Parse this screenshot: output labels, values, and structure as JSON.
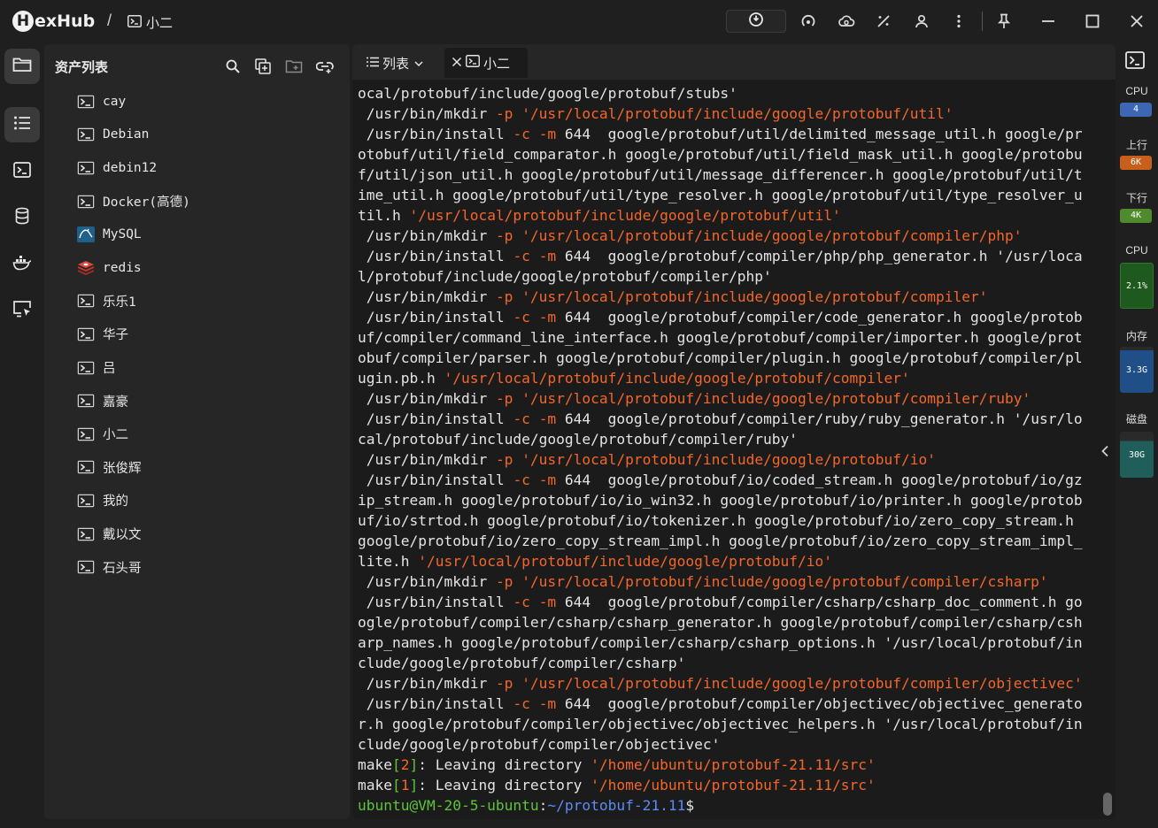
{
  "app": {
    "logo_letter": "H",
    "logo_text": "exHub",
    "breadcrumb_sep": "/",
    "breadcrumb_current": "小二"
  },
  "asset_panel": {
    "title": "资产列表",
    "items": [
      {
        "label": "cay",
        "icon": "terminal-icon"
      },
      {
        "label": "Debian",
        "icon": "terminal-icon"
      },
      {
        "label": "debin12",
        "icon": "terminal-icon"
      },
      {
        "label": "Docker(高德)",
        "icon": "terminal-icon"
      },
      {
        "label": "MySQL",
        "icon": "mysql-icon"
      },
      {
        "label": "redis",
        "icon": "redis-icon"
      },
      {
        "label": "乐乐1",
        "icon": "terminal-icon"
      },
      {
        "label": "华子",
        "icon": "terminal-icon"
      },
      {
        "label": "吕",
        "icon": "terminal-icon"
      },
      {
        "label": "嘉豪",
        "icon": "terminal-icon"
      },
      {
        "label": "小二",
        "icon": "terminal-icon"
      },
      {
        "label": "张俊辉",
        "icon": "terminal-icon"
      },
      {
        "label": "我的",
        "icon": "terminal-icon"
      },
      {
        "label": "戴以文",
        "icon": "terminal-icon"
      },
      {
        "label": "石头哥",
        "icon": "terminal-icon"
      }
    ]
  },
  "tabs": {
    "list_label": "列表",
    "active_label": "小二"
  },
  "terminal": {
    "lines": [
      [
        [
          "w",
          "ocal/protobuf/include/google/protobuf/stubs'"
        ]
      ],
      [
        [
          "w",
          " /usr/bin/mkdir "
        ],
        [
          "o",
          "-p"
        ],
        [
          "w",
          " "
        ],
        [
          "o",
          "'/usr/local/protobuf/include/google/protobuf/util'"
        ]
      ],
      [
        [
          "w",
          " /usr/bin/install "
        ],
        [
          "o",
          "-c"
        ],
        [
          "w",
          " "
        ],
        [
          "o",
          "-m"
        ],
        [
          "w",
          " 644  google/protobuf/util/delimited_message_util.h google/pr"
        ]
      ],
      [
        [
          "w",
          "otobuf/util/field_comparator.h google/protobuf/util/field_mask_util.h google/protobu"
        ]
      ],
      [
        [
          "w",
          "f/util/json_util.h google/protobuf/util/message_differencer.h google/protobuf/util/t"
        ]
      ],
      [
        [
          "w",
          "ime_util.h google/protobuf/util/type_resolver.h google/protobuf/util/type_resolver_u"
        ]
      ],
      [
        [
          "w",
          "til.h "
        ],
        [
          "o",
          "'/usr/local/protobuf/include/google/protobuf/util'"
        ]
      ],
      [
        [
          "w",
          " /usr/bin/mkdir "
        ],
        [
          "o",
          "-p"
        ],
        [
          "w",
          " "
        ],
        [
          "o",
          "'/usr/local/protobuf/include/google/protobuf/compiler/php'"
        ]
      ],
      [
        [
          "w",
          " /usr/bin/install "
        ],
        [
          "o",
          "-c"
        ],
        [
          "w",
          " "
        ],
        [
          "o",
          "-m"
        ],
        [
          "w",
          " 644  google/protobuf/compiler/php/php_generator.h '/usr/loca"
        ]
      ],
      [
        [
          "w",
          "l/protobuf/include/google/protobuf/compiler/php'"
        ]
      ],
      [
        [
          "w",
          " /usr/bin/mkdir "
        ],
        [
          "o",
          "-p"
        ],
        [
          "w",
          " "
        ],
        [
          "o",
          "'/usr/local/protobuf/include/google/protobuf/compiler'"
        ]
      ],
      [
        [
          "w",
          " /usr/bin/install "
        ],
        [
          "o",
          "-c"
        ],
        [
          "w",
          " "
        ],
        [
          "o",
          "-m"
        ],
        [
          "w",
          " 644  google/protobuf/compiler/code_generator.h google/protob"
        ]
      ],
      [
        [
          "w",
          "uf/compiler/command_line_interface.h google/protobuf/compiler/importer.h google/prot"
        ]
      ],
      [
        [
          "w",
          "obuf/compiler/parser.h google/protobuf/compiler/plugin.h google/protobuf/compiler/pl"
        ]
      ],
      [
        [
          "w",
          "ugin.pb.h "
        ],
        [
          "o",
          "'/usr/local/protobuf/include/google/protobuf/compiler'"
        ]
      ],
      [
        [
          "w",
          " /usr/bin/mkdir "
        ],
        [
          "o",
          "-p"
        ],
        [
          "w",
          " "
        ],
        [
          "o",
          "'/usr/local/protobuf/include/google/protobuf/compiler/ruby'"
        ]
      ],
      [
        [
          "w",
          " /usr/bin/install "
        ],
        [
          "o",
          "-c"
        ],
        [
          "w",
          " "
        ],
        [
          "o",
          "-m"
        ],
        [
          "w",
          " 644  google/protobuf/compiler/ruby/ruby_generator.h '/usr/lo"
        ]
      ],
      [
        [
          "w",
          "cal/protobuf/include/google/protobuf/compiler/ruby'"
        ]
      ],
      [
        [
          "w",
          " /usr/bin/mkdir "
        ],
        [
          "o",
          "-p"
        ],
        [
          "w",
          " "
        ],
        [
          "o",
          "'/usr/local/protobuf/include/google/protobuf/io'"
        ]
      ],
      [
        [
          "w",
          " /usr/bin/install "
        ],
        [
          "o",
          "-c"
        ],
        [
          "w",
          " "
        ],
        [
          "o",
          "-m"
        ],
        [
          "w",
          " 644  google/protobuf/io/coded_stream.h google/protobuf/io/gz"
        ]
      ],
      [
        [
          "w",
          "ip_stream.h google/protobuf/io/io_win32.h google/protobuf/io/printer.h google/protob"
        ]
      ],
      [
        [
          "w",
          "uf/io/strtod.h google/protobuf/io/tokenizer.h google/protobuf/io/zero_copy_stream.h"
        ]
      ],
      [
        [
          "w",
          "google/protobuf/io/zero_copy_stream_impl.h google/protobuf/io/zero_copy_stream_impl_"
        ]
      ],
      [
        [
          "w",
          "lite.h "
        ],
        [
          "o",
          "'/usr/local/protobuf/include/google/protobuf/io'"
        ]
      ],
      [
        [
          "w",
          " /usr/bin/mkdir "
        ],
        [
          "o",
          "-p"
        ],
        [
          "w",
          " "
        ],
        [
          "o",
          "'/usr/local/protobuf/include/google/protobuf/compiler/csharp'"
        ]
      ],
      [
        [
          "w",
          " /usr/bin/install "
        ],
        [
          "o",
          "-c"
        ],
        [
          "w",
          " "
        ],
        [
          "o",
          "-m"
        ],
        [
          "w",
          " 644  google/protobuf/compiler/csharp/csharp_doc_comment.h go"
        ]
      ],
      [
        [
          "w",
          "ogle/protobuf/compiler/csharp/csharp_generator.h google/protobuf/compiler/csharp/csh"
        ]
      ],
      [
        [
          "w",
          "arp_names.h google/protobuf/compiler/csharp/csharp_options.h '/usr/local/protobuf/in"
        ]
      ],
      [
        [
          "w",
          "clude/google/protobuf/compiler/csharp'"
        ]
      ],
      [
        [
          "w",
          " /usr/bin/mkdir "
        ],
        [
          "o",
          "-p"
        ],
        [
          "w",
          " "
        ],
        [
          "o",
          "'/usr/local/protobuf/include/google/protobuf/compiler/objectivec'"
        ]
      ],
      [
        [
          "w",
          " /usr/bin/install "
        ],
        [
          "o",
          "-c"
        ],
        [
          "w",
          " "
        ],
        [
          "o",
          "-m"
        ],
        [
          "w",
          " 644  google/protobuf/compiler/objectivec/objectivec_generato"
        ]
      ],
      [
        [
          "w",
          "r.h google/protobuf/compiler/objectivec/objectivec_helpers.h '/usr/local/protobuf/in"
        ]
      ],
      [
        [
          "w",
          "clude/google/protobuf/compiler/objectivec'"
        ]
      ],
      [
        [
          "w",
          "make"
        ],
        [
          "g",
          "["
        ],
        [
          "o",
          "2"
        ],
        [
          "g",
          "]"
        ],
        [
          "w",
          ": Leaving directory "
        ],
        [
          "o",
          "'/home/ubuntu/protobuf-21.11/src'"
        ]
      ],
      [
        [
          "w",
          "make"
        ],
        [
          "g",
          "["
        ],
        [
          "o",
          "1"
        ],
        [
          "g",
          "]"
        ],
        [
          "w",
          ": Leaving directory "
        ],
        [
          "o",
          "'/home/ubuntu/protobuf-21.11/src'"
        ]
      ],
      [
        [
          "g",
          "ubuntu@VM-20-5-ubuntu"
        ],
        [
          "w",
          ":"
        ],
        [
          "b",
          "~/protobuf-21.11"
        ],
        [
          "w",
          "$"
        ]
      ]
    ]
  },
  "monitor": {
    "cpu_label": "CPU",
    "cpu_cores": "4",
    "upload_label": "上行",
    "upload_value": "6K",
    "download_label": "下行",
    "download_value": "4K",
    "cpu_usage_label": "CPU",
    "cpu_usage_value": "2.1%",
    "mem_label": "内存",
    "mem_value": "3.3G",
    "disk_label": "磁盘",
    "disk_value": "30G"
  },
  "colors": {
    "orange": "#f4672a",
    "green": "#5fc43a",
    "blue": "#5a8cf7",
    "badge_blue": "#3d67b5",
    "badge_orange": "#c8601c",
    "badge_green": "#4f8a2c"
  }
}
